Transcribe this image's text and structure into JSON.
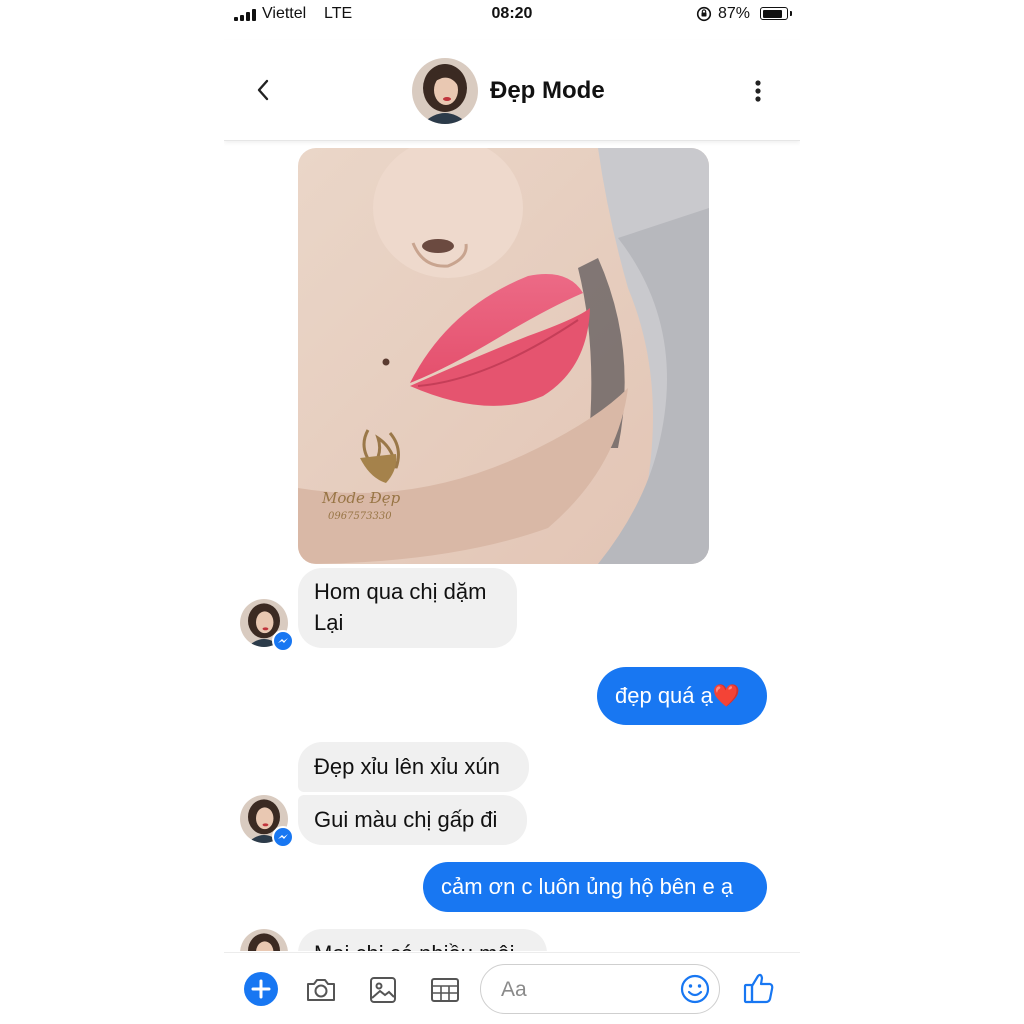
{
  "status_bar": {
    "carrier": "Viettel",
    "network": "LTE",
    "time": "08:20",
    "battery": "87%",
    "battery_level": 0.87
  },
  "header": {
    "contact_name": "Đẹp Mode",
    "back_icon": "chevron-left-icon",
    "more_icon": "vertical-ellipsis-icon"
  },
  "photo_message": {
    "watermark_brand": "Mode Đẹp",
    "watermark_phone": "0967573330"
  },
  "messages": [
    {
      "sender": "contact",
      "lines": [
        "Hom qua chị dặm",
        "Lại"
      ]
    },
    {
      "sender": "me",
      "text": "đẹp quá ạ",
      "emoji": "❤️"
    },
    {
      "sender": "contact",
      "text": "Đẹp xỉu lên xỉu xún"
    },
    {
      "sender": "contact",
      "text": "Gui màu chị gấp đi"
    },
    {
      "sender": "me",
      "text": "cảm ơn c luôn ủng hộ bên e ạ"
    },
    {
      "sender": "contact",
      "text": "Mai chị có nhiều môi"
    }
  ],
  "composer": {
    "placeholder": "Aa",
    "icons": [
      "plus-icon",
      "camera-icon",
      "image-icon",
      "sticker-grid-icon",
      "emoji-icon",
      "thumbs-up-icon"
    ]
  },
  "colors": {
    "accent": "#1877f2",
    "incoming_bubble": "#f0f0f0",
    "text": "#111111"
  }
}
